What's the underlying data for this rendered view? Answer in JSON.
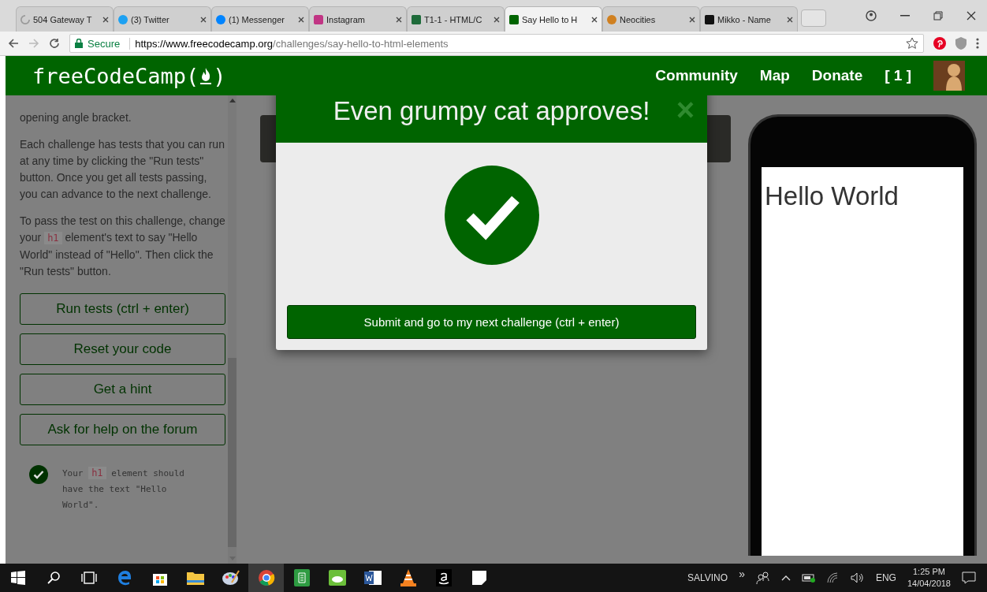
{
  "browser": {
    "tabs": [
      {
        "title": "504 Gateway T",
        "selected": false
      },
      {
        "title": "(3) Twitter",
        "selected": false
      },
      {
        "title": "(1) Messenger",
        "selected": false
      },
      {
        "title": "Instagram",
        "selected": false
      },
      {
        "title": "T1-1 - HTML/C",
        "selected": false
      },
      {
        "title": "Say Hello to H",
        "selected": true
      },
      {
        "title": "Neocities",
        "selected": false
      },
      {
        "title": "Mikko - Name",
        "selected": false
      }
    ],
    "secure_label": "Secure",
    "url_host": "https://www.freecodecamp.org",
    "url_path": "/challenges/say-hello-to-html-elements"
  },
  "navbar": {
    "logo_start": "freeCodeCamp(",
    "logo_end": ")",
    "links": [
      "Community",
      "Map",
      "Donate"
    ],
    "points": "[ 1 ]"
  },
  "instructions": {
    "paragraphs": [
      [
        {
          "kind": "text",
          "text": "opening angle bracket."
        }
      ],
      [
        {
          "kind": "text",
          "text": "Each challenge has tests that you can run at any time by clicking the \"Run tests\" button. Once you get all tests passing, you can advance to the next challenge."
        }
      ],
      [
        {
          "kind": "text",
          "text": "To pass the test on this challenge, change your "
        },
        {
          "kind": "code",
          "text": "h1"
        },
        {
          "kind": "text",
          "text": " element's text to say \"Hello World\" instead of \"Hello\". Then click the \"Run tests\" button."
        }
      ]
    ],
    "buttons": [
      "Run tests (ctrl + enter)",
      "Reset your code",
      "Get a hint",
      "Ask for help on the forum"
    ]
  },
  "tests": [
    {
      "passed": true,
      "text": [
        {
          "kind": "text",
          "text": "Your "
        },
        {
          "kind": "code",
          "text": "h1"
        },
        {
          "kind": "text",
          "text": " element should have the text \"Hello World\"."
        }
      ]
    }
  ],
  "modal": {
    "title": "Even grumpy cat approves!",
    "close": "×",
    "submit": "Submit and go to my next challenge (ctrl + enter)"
  },
  "preview": {
    "heading": "Hello World"
  },
  "taskbar": {
    "apps": [
      {
        "kind": "start",
        "selected": false
      },
      {
        "kind": "search",
        "selected": false
      },
      {
        "kind": "taskview",
        "selected": false
      },
      {
        "kind": "edge",
        "selected": false
      },
      {
        "kind": "store",
        "selected": false
      },
      {
        "kind": "folder",
        "selected": false
      },
      {
        "kind": "paint",
        "selected": false
      },
      {
        "kind": "chrome",
        "selected": true
      },
      {
        "kind": "notes",
        "selected": false
      },
      {
        "kind": "cloud",
        "selected": false
      },
      {
        "kind": "word",
        "selected": false
      },
      {
        "kind": "cone",
        "selected": false
      },
      {
        "kind": "amazon",
        "selected": false
      },
      {
        "kind": "sticky",
        "selected": false
      }
    ],
    "user": "SALVINO",
    "overflow": "»",
    "language": "ENG",
    "time": "1:25 PM",
    "date": "14/04/2018"
  }
}
